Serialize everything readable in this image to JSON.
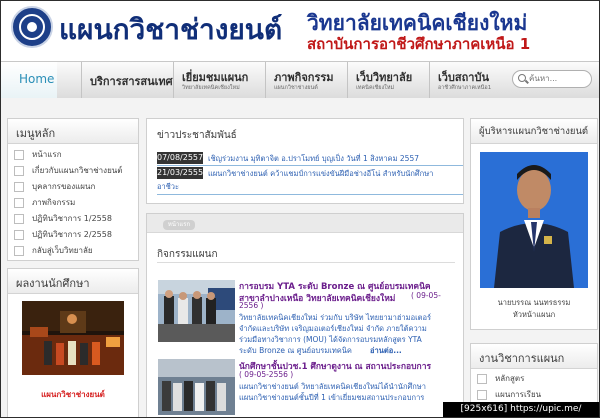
{
  "header": {
    "site_title": "แผนกวิชาช่างยนต์",
    "college_name": "วิทยาลัยเทคนิคเชียงใหม่",
    "institute_name": "สถาบันการอาชีวศึกษาภาคเหนือ 1"
  },
  "nav": {
    "home": "Home",
    "items": [
      {
        "label": "บริการสารสนเทศ",
        "sub": ""
      },
      {
        "label": "เยี่ยมชมแผนก",
        "sub": "วิทยาลัยเทคนิคเชียงใหม่"
      },
      {
        "label": "ภาพกิจกรรม",
        "sub": "แผนกวิชาช่างยนต์"
      },
      {
        "label": "เว็บวิทยาลัย",
        "sub": "เทคนิคเชียงใหม่"
      },
      {
        "label": "เว็บสถาบัน",
        "sub": "อาชีวศึกษาภาคเหนือ1"
      }
    ],
    "search_placeholder": "ค้นหา..."
  },
  "main_menu": {
    "title": "เมนูหลัก",
    "items": [
      "หน้าแรก",
      "เกี่ยวกับแผนกวิชาช่างยนต์",
      "บุคลากรของแผนก",
      "ภาพกิจกรรม",
      "ปฏิทินวิชาการ 1/2558",
      "ปฏิทินวิชาการ 2/2558",
      "กลับสู่เว็บวิทยาลัย"
    ]
  },
  "student_work": {
    "title": "ผลงานนักศึกษา",
    "caption": "แผนกวิชาช่างยนต์"
  },
  "news": {
    "title": "ข่าวประชาสัมพันธ์",
    "items": [
      {
        "date": "07/08/2557",
        "text": "เชิญร่วมงาน มุทิตาจิต อ.ปราโมทย์ บุญเป็ง วันที่ 1 สิงหาคม 2557"
      },
      {
        "date": "21/03/2555",
        "text": "แผนกวิชาช่างยนต์ คว้าแชมป์การแข่งขันฝีมือช่างอีโน่ สำหรับนักศึกษา",
        "text2": "อาชีวะ"
      }
    ]
  },
  "activities": {
    "tab": "หน้าแรก",
    "title": "กิจกรรมแผนก",
    "items": [
      {
        "title": "การอบรม YTA ระดับ Bronze ณ ศูนย์อบรมเทคนิค",
        "title2": "สาขาลำปางเหนือ วิทยาลัยเทคนิคเชียงใหม่",
        "date": "( 09-05-",
        "date2": "2556 )",
        "body": [
          "วิทยาลัยเทคนิคเชียงใหม่ ร่วมกับ บริษัท ไทยยามาฮ่ามอเตอร์",
          "จำกัดและบริษัท เจริญมอเตอร์เชียงใหม่ จำกัด ภายใต้ความ",
          "ร่วมมือทางวิชาการ (MOU) ได้จัดการอบรมหลักสูตร YTA",
          "ระดับ Bronze ณ ศูนย์อบรมเทคนิค ",
          "อ่านต่อ..."
        ]
      },
      {
        "title": "นักศึกษาชั้นปวช.1 ศึกษาดูงาน ณ สถานประกอบการ",
        "date": "( 09-05-2556 )",
        "body": [
          "แผนกวิชาช่างยนต์ วิทยาลัยเทคนิคเชียงใหม่ได้นำนักศึกษา",
          "แผนกวิชาช่างยนต์ชั้นปีที่ 1 เข้าเยี่ยมชมสถานประกอบการ"
        ]
      }
    ]
  },
  "head_of_dept": {
    "title": "ผู้บริหารแผนกวิชาช่างยนต์",
    "name": "นายบรรณ นนทรธรรม",
    "role": "หัวหน้าแผนก"
  },
  "academic": {
    "title": "งานวิชาการแผนก",
    "items": [
      "หลักสูตร",
      "แผนการเรียน"
    ]
  },
  "watermark": "[925x616] https://upic.me/",
  "colors": {
    "title_blue": "#102e78",
    "institute_red": "#c01818",
    "link_blue": "#2d60b2",
    "activity_purple": "#6b1e8c",
    "nav_home": "#2a8fb7"
  }
}
